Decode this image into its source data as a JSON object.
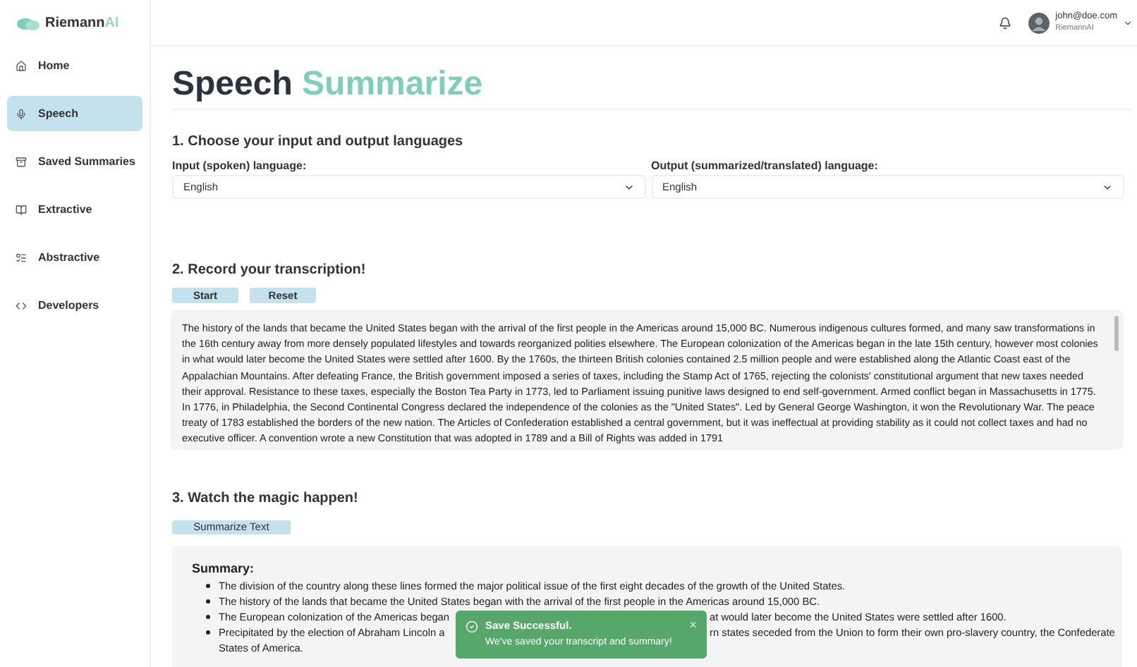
{
  "app": {
    "name": "Riemann",
    "name_accent": "AI"
  },
  "sidebar": {
    "items": [
      {
        "label": "Home",
        "selected": false
      },
      {
        "label": "Speech",
        "selected": true
      },
      {
        "label": "Saved Summaries",
        "selected": false
      },
      {
        "label": "Extractive",
        "selected": false
      },
      {
        "label": "Abstractive",
        "selected": false
      },
      {
        "label": "Developers",
        "selected": false
      }
    ]
  },
  "user": {
    "email": "john@doe.com",
    "org": "RiemannAI"
  },
  "title": {
    "main": "Speech",
    "accent": "Summarize"
  },
  "section_1": {
    "heading": "1. Choose your input and output languages",
    "input": {
      "label": "Input (spoken) language:",
      "value": "English"
    },
    "output": {
      "label": "Output (summarized/translated) language:",
      "value": "English"
    }
  },
  "section_2": {
    "heading": "2. Record your transcription!",
    "buttons": [
      "Start",
      "Reset"
    ],
    "transcript": "The history of the lands that became the United States began with the arrival of the first people in the Americas around 15,000 BC. Numerous indigenous cultures formed, and many saw transformations in the 16th century away from more densely populated lifestyles and towards reorganized polities elsewhere. The European colonization of the Americas began in the late 15th century, however most colonies in what would later become the United States were settled after 1600. By the 1760s, the thirteen British colonies contained 2.5 million people and were established along the Atlantic Coast east of the Appalachian Mountains. After defeating France, the British government imposed a series of taxes, including the Stamp Act of 1765, rejecting the colonists' constitutional argument that new taxes needed their approval. Resistance to these taxes, especially the Boston Tea Party in 1773, led to Parliament issuing punitive laws designed to end self-government. Armed conflict began in Massachusetts in 1775. In 1776, in Philadelphia, the Second Continental Congress declared the independence of the colonies as the \"United States\". Led by General George Washington, it won the Revolutionary War. The peace treaty of 1783 established the borders of the new nation. The Articles of Confederation established a central government, but it was ineffectual at providing stability as it could not collect taxes and had no executive officer. A convention wrote a new Constitution that was adopted in 1789 and a Bill of Rights was added in 1791"
  },
  "section_3": {
    "heading": "3. Watch the magic happen!",
    "button": "Summarize Text",
    "summary_heading": "Summary:",
    "bullets": [
      {
        "before": "The division of the country along these lines formed the major political issue of the first eight decades of the growth of the United States."
      },
      {
        "before": "The history of the lands that became the United States began with the arrival of the first people in the Americas around 15,000 BC."
      },
      {
        "before": "The European colonization of the Americas began",
        "after": "at would later become the United States were settled after 1600."
      },
      {
        "before": "Precipitated by the election of Abraham Lincoln a",
        "after": "rn states seceded from the Union to form their own pro-slavery country, the Confederate",
        "continued": "States of America."
      }
    ]
  },
  "toast": {
    "title": "Save Successful.",
    "message": "We've saved your transcript and summary!",
    "close": "×"
  }
}
